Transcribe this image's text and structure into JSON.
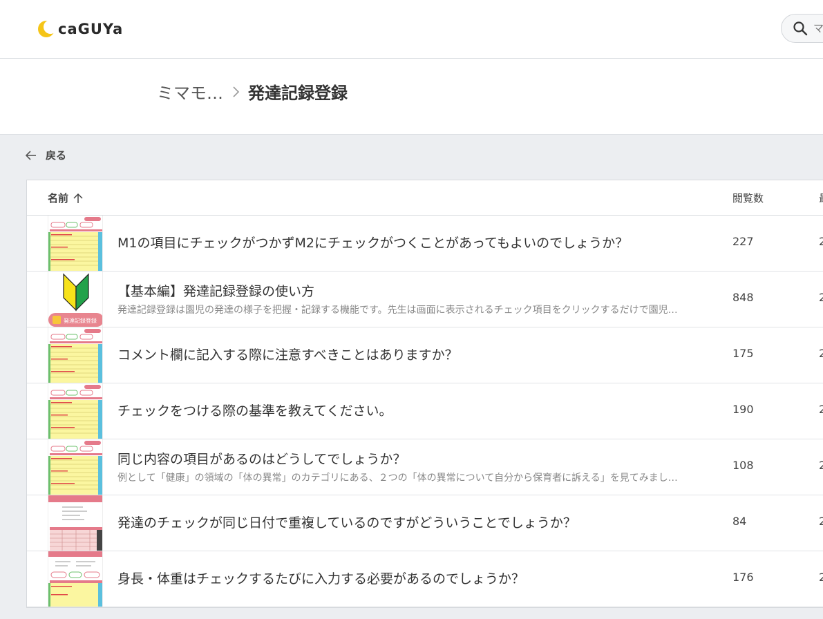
{
  "brand": {
    "logo_text": "caGUYa",
    "accent": "#f5c518"
  },
  "search": {
    "placeholder": "マ"
  },
  "breadcrumb": {
    "parent": "ミマモ…",
    "current": "発達記録登録"
  },
  "nav": {
    "back_label": "戻る"
  },
  "table": {
    "columns": {
      "name": "名前",
      "views": "閲覧数",
      "date": "最"
    },
    "rows": [
      {
        "title": "M1の項目にチェックがつかずM2にチェックがつくことがあってもよいのでしょうか？",
        "description": "",
        "views": "227",
        "date": "2",
        "thumb": "doc-yellow"
      },
      {
        "title": "【基本編】発達記録登録の使い方",
        "description": "発達記録登録は園児の発達の様子を把握・記録する機能です。先生は画面に表示されるチェック項目をクリックするだけで園児…",
        "views": "848",
        "date": "2",
        "thumb": "beginner",
        "thumb_label": "発達記録登録"
      },
      {
        "title": "コメント欄に記入する際に注意すべきことはありますか？",
        "description": "",
        "views": "175",
        "date": "2",
        "thumb": "doc-yellow"
      },
      {
        "title": "チェックをつける際の基準を教えてください。",
        "description": "",
        "views": "190",
        "date": "2",
        "thumb": "doc-yellow"
      },
      {
        "title": "同じ内容の項目があるのはどうしてでしょうか？",
        "description": "例として「健康」の領域の「体の異常」のカテゴリにある、２つの「体の異常について自分から保育者に訴える」を見てみまし…",
        "views": "108",
        "date": "2",
        "thumb": "doc-yellow"
      },
      {
        "title": "発達のチェックが同じ日付で重複しているのですがどういうことでしょうか？",
        "description": "",
        "views": "84",
        "date": "2",
        "thumb": "doc-table"
      },
      {
        "title": "身長・体重はチェックするたびに入力する必要があるのでしょうか？",
        "description": "",
        "views": "176",
        "date": "2",
        "thumb": "doc-form"
      }
    ]
  }
}
